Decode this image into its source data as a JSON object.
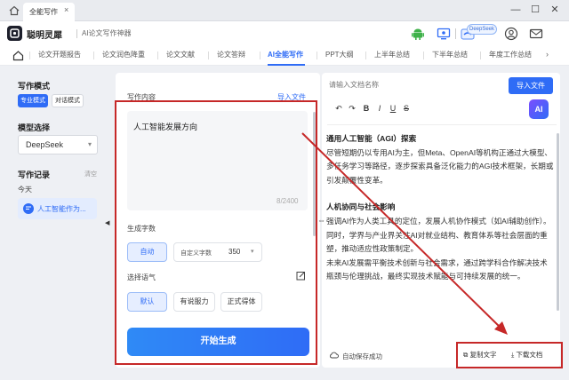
{
  "titlebar": {
    "tab_label": "全能写作",
    "close": "×",
    "minimize": "—",
    "maximize": "☐",
    "window_close": "✕"
  },
  "header": {
    "brand": "聪明灵犀",
    "subtitle": "AI论文写作神器",
    "badge": "DeepSeek",
    "icons": [
      "android-icon",
      "pc-icon",
      "deepseek-icon",
      "user-icon",
      "mail-icon"
    ]
  },
  "nav": {
    "items": [
      {
        "label": "论文开题报告",
        "active": false
      },
      {
        "label": "论文润色降重",
        "active": false
      },
      {
        "label": "论文文献",
        "active": false
      },
      {
        "label": "论文答辩",
        "active": false
      },
      {
        "label": "AI全能写作",
        "active": true
      },
      {
        "label": "PPT大纲",
        "active": false
      },
      {
        "label": "上半年总结",
        "active": false
      },
      {
        "label": "下半年总结",
        "active": false
      },
      {
        "label": "年度工作总结",
        "active": false
      }
    ],
    "accent": "#2f6cf6"
  },
  "sidebar": {
    "mode_heading": "写作模式",
    "mode_pro": "专业模式",
    "mode_dialog": "对话模式",
    "model_heading": "模型选择",
    "model_value": "DeepSeek",
    "history_heading": "写作记录",
    "clear": "清空",
    "today": "今天",
    "history_item": "人工智能作为..."
  },
  "middle": {
    "content_label": "写作内容",
    "import_link": "导入文件",
    "input_text": "人工智能发展方向",
    "char_count": "8/2400",
    "word_count_label": "生成字数",
    "auto": "自动",
    "custom_label": "自定义字数",
    "custom_value": "350",
    "tone_label": "选择语气",
    "tones": [
      "默认",
      "有说服力",
      "正式得体"
    ],
    "generate": "开始生成"
  },
  "right": {
    "filename_placeholder": "请输入文档名称",
    "import_btn": "导入文件",
    "toolbar": [
      "↶",
      "↷",
      "B",
      "I",
      "U",
      "S"
    ],
    "ai_label": "AI",
    "doc": {
      "h1": "通用人工智能（AGI）探索",
      "p1": "尽管短期仍以专用AI为主，但Meta、OpenAI等机构正通过大模型、多任务学习等路径，逐步探索具备泛化能力的AGI技术框架，长期或引发颠覆性变革。",
      "h2": "人机协同与社会影响",
      "p2": "强调AI作为人类工具的定位，发展人机协作模式（如AI辅助创作）。同时，学界与产业界关注AI对就业结构、教育体系等社会层面的重塑，推动适应性政策制定。",
      "p3": "未来AI发展需平衡技术创新与社会需求，通过跨学科合作解决技术瓶颈与伦理挑战，最终实现技术赋能与可持续发展的统一。"
    },
    "autosave": "自动保存成功",
    "copy": "复制文字",
    "download": "下载文档"
  },
  "annotation_color": "#c62828"
}
